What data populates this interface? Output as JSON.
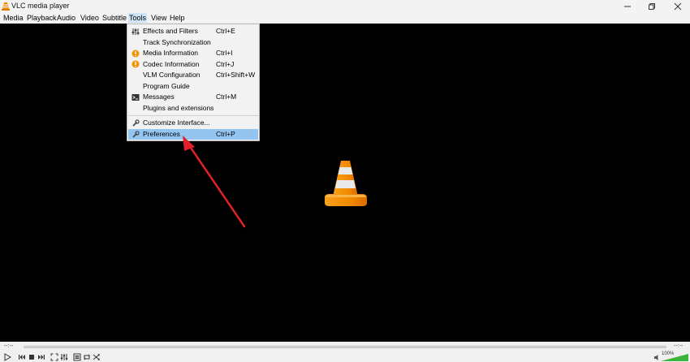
{
  "window": {
    "title": "VLC media player",
    "app_icon": "vlc-cone-icon",
    "controls": [
      "minimize-icon",
      "restore-icon",
      "close-icon"
    ]
  },
  "menubar": {
    "items": [
      {
        "label": "Media"
      },
      {
        "label": "Playback"
      },
      {
        "label": "Audio"
      },
      {
        "label": "Video"
      },
      {
        "label": "Subtitle"
      },
      {
        "label": "Tools"
      },
      {
        "label": "View"
      },
      {
        "label": "Help"
      }
    ],
    "open_menu": "Tools"
  },
  "tools_menu": {
    "items": [
      {
        "label": "Effects and Filters",
        "shortcut": "Ctrl+E",
        "icon": "equalizer-icon"
      },
      {
        "label": "Track Synchronization",
        "shortcut": "",
        "icon": ""
      },
      {
        "label": "Media Information",
        "shortcut": "Ctrl+I",
        "icon": "info-icon"
      },
      {
        "label": "Codec Information",
        "shortcut": "Ctrl+J",
        "icon": "info-icon"
      },
      {
        "label": "VLM Configuration",
        "shortcut": "Ctrl+Shift+W",
        "icon": ""
      },
      {
        "label": "Program Guide",
        "shortcut": "",
        "icon": ""
      },
      {
        "label": "Messages",
        "shortcut": "Ctrl+M",
        "icon": "terminal-icon"
      },
      {
        "label": "Plugins and extensions",
        "shortcut": "",
        "icon": ""
      },
      {
        "label": "Customize Interface...",
        "shortcut": "",
        "icon": "wrench-icon"
      },
      {
        "label": "Preferences",
        "shortcut": "Ctrl+P",
        "icon": "wrench-icon",
        "highlighted": true
      }
    ]
  },
  "player": {
    "elapsed": "--:--",
    "remaining": "--:--",
    "volume": "100%",
    "volume_level": 1.0,
    "buttons": [
      "play-icon",
      "previous-icon",
      "stop-icon",
      "next-icon",
      "fullscreen-icon",
      "extended-settings-icon",
      "playlist-icon",
      "loop-icon",
      "shuffle-icon"
    ]
  },
  "colors": {
    "accent_highlight": "#94c5f1",
    "info_orange": "#f39200",
    "annotation_arrow": "#e0202a",
    "volume_green": "#3cb43c"
  }
}
